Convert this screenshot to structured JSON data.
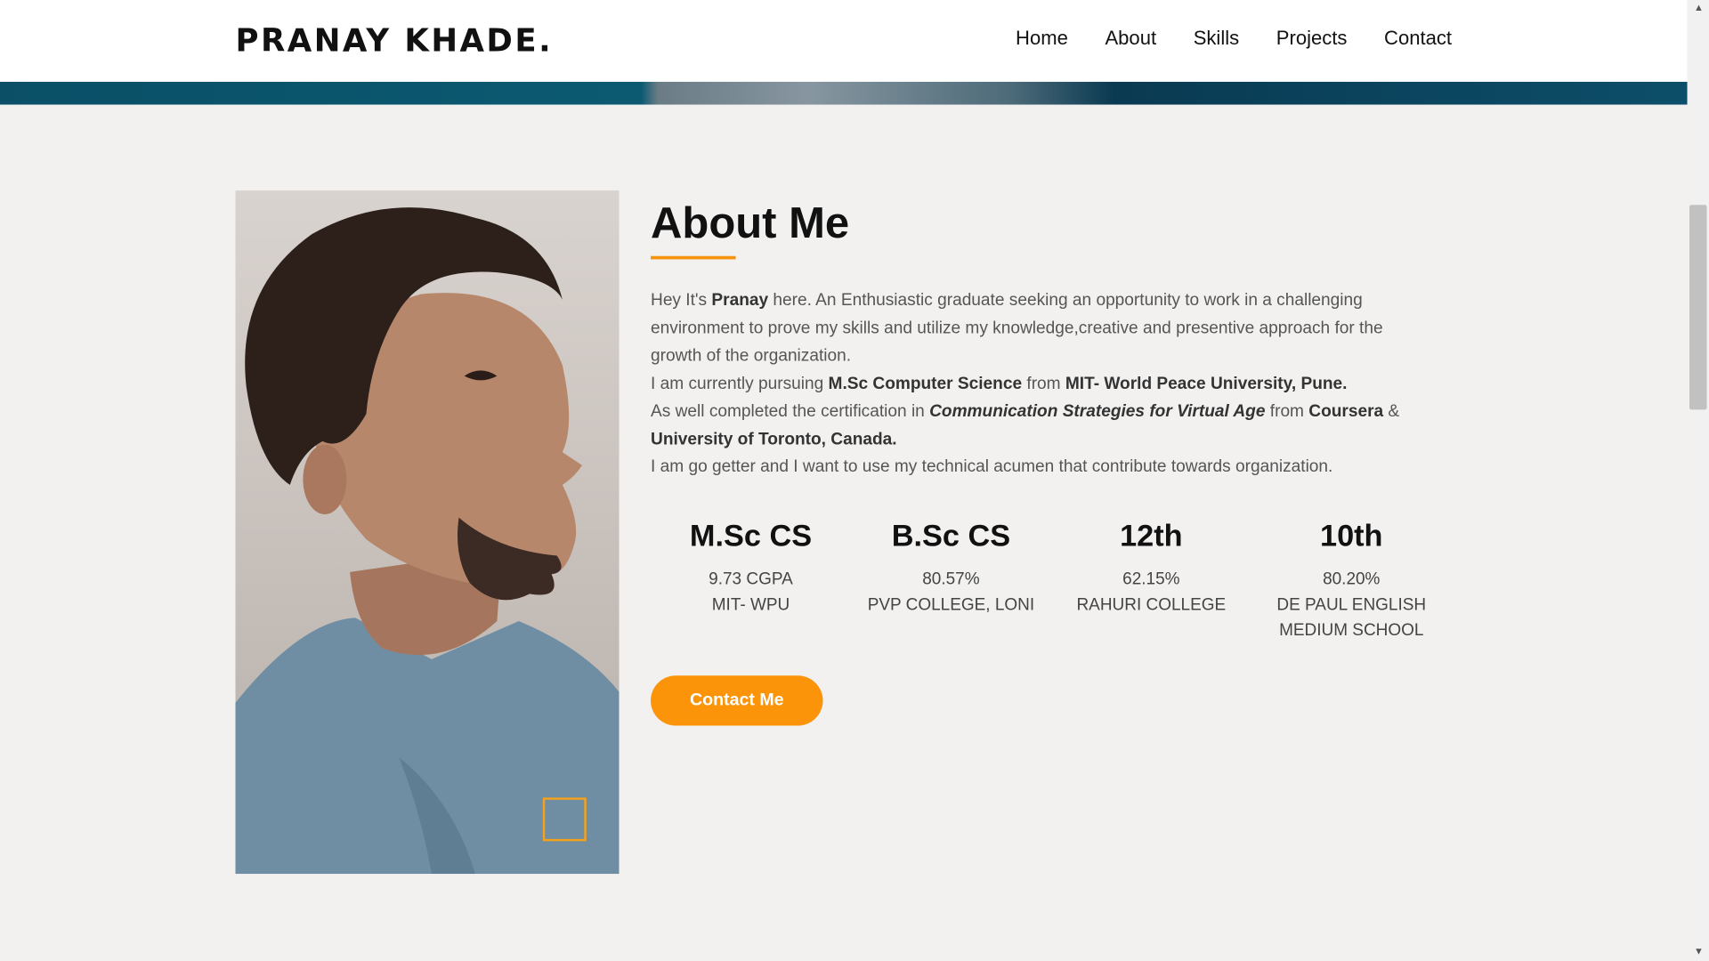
{
  "navbar": {
    "brand": "PRANAY KHADE.",
    "links": [
      {
        "label": "Home"
      },
      {
        "label": "About"
      },
      {
        "label": "Skills"
      },
      {
        "label": "Projects"
      },
      {
        "label": "Contact"
      }
    ]
  },
  "about": {
    "title": "About Me",
    "intro": {
      "p1_a": "Hey It's ",
      "p1_name": "Pranay",
      "p1_b": " here. An Enthusiastic graduate seeking an opportunity to work in a challenging environment to prove my skills and utilize my knowledge,creative and presentive approach for the growth of the organization.",
      "p2_a": "I am currently pursuing ",
      "p2_course": "M.Sc Computer Science",
      "p2_b": " from ",
      "p2_univ": "MIT- World Peace University, Pune.",
      "p3_a": "As well completed the certification in ",
      "p3_cert": "Communication Strategies for Virtual Age",
      "p3_b": " from ",
      "p3_org": "Coursera",
      "p3_c": " & ",
      "p3_univ": "University of Toronto, Canada.",
      "p4": "I am go getter and I want to use my technical acumen that contribute towards organization."
    },
    "education": [
      {
        "degree": "M.Sc CS",
        "score": "9.73 CGPA",
        "institution": "MIT- WPU"
      },
      {
        "degree": "B.Sc CS",
        "score": "80.57%",
        "institution": "PVP COLLEGE, LONI"
      },
      {
        "degree": "12th",
        "score": "62.15%",
        "institution": "RAHURI COLLEGE"
      },
      {
        "degree": "10th",
        "score": "80.20%",
        "institution": "DE PAUL ENGLISH MEDIUM SCHOOL"
      }
    ],
    "contact_button": "Contact Me"
  },
  "colors": {
    "accent": "#fb9408",
    "hero": "#0a4f66",
    "background": "#f2f1f0"
  }
}
